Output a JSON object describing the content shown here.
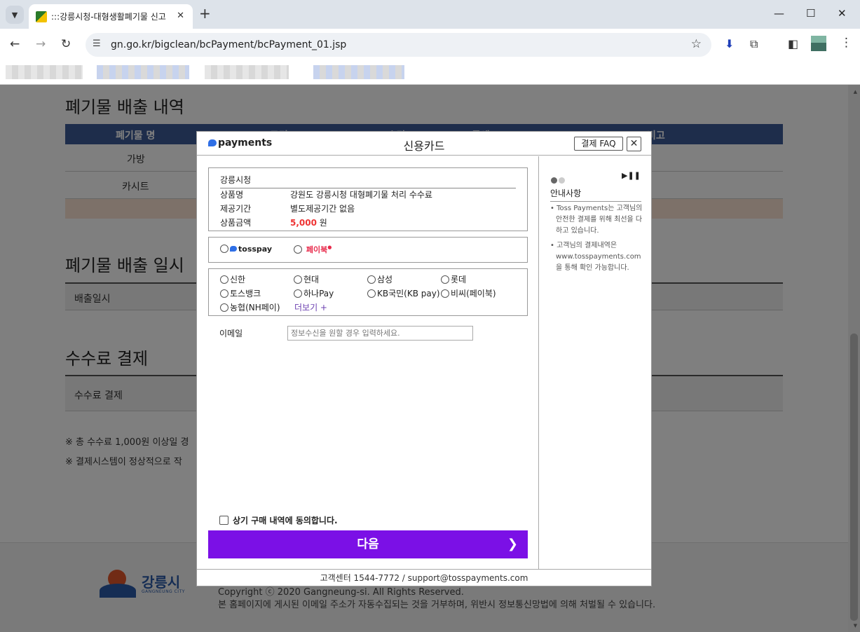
{
  "browser": {
    "tab_title": ":::강릉시청-대형생활폐기물 신고",
    "url": "gn.go.kr/bigclean/bcPayment/bcPayment_01.jsp"
  },
  "page": {
    "section1_title": "폐기물 배출 내역",
    "table_headers": [
      "폐기물 명",
      "규격",
      "수량",
      "금액",
      "비고"
    ],
    "table_rows": [
      {
        "name": "가방"
      },
      {
        "name": "카시트"
      }
    ],
    "section2_title": "폐기물 배출 일시",
    "dispose_label": "배출일시",
    "section3_title": "수수료 결제",
    "fee_label": "수수료 결제",
    "note1": "※ 총 수수료 1,000원 이상일 경",
    "note2": "※ 결제시스템이 정상적으로 작",
    "footer": {
      "logo_text": "강릉시",
      "logo_sub": "GANGNEUNG CITY",
      "copyright": "Copyright ⓒ 2020 Gangneung-si. All Rights Reserved.",
      "notice": "본 홈페이지에 게시된 이메일 주소가 자동수집되는 것을 거부하며, 위반시 정보통신망법에 의해 처벌될 수 있습니다."
    }
  },
  "modal": {
    "brand": "payments",
    "title": "신용카드",
    "faq_label": "결제 FAQ",
    "close_label": "✕",
    "merchant": "강릉시청",
    "product_label": "상품명",
    "product_value": "강원도 강릉시청 대형폐기물 처리 수수료",
    "period_label": "제공기간",
    "period_value": "별도제공기간 없음",
    "amount_label": "상품금액",
    "amount_value": "5,000",
    "amount_unit": "원",
    "easy_pay": [
      "tosspay",
      "페이북"
    ],
    "cards": [
      "신한",
      "현대",
      "삼성",
      "롯데",
      "토스뱅크",
      "하나Pay",
      "KB국민(KB pay)",
      "비씨(페이북)",
      "농협(NH페이)"
    ],
    "more_label": "더보기 +",
    "email_label": "이메일",
    "email_placeholder": "정보수신을 원할 경우 입력하세요.",
    "agree_label": "상기 구매 내역에 동의합니다.",
    "next_label": "다음",
    "guide_title": "안내사항",
    "guide_items": [
      "• Toss Payments는 고객님의 안전한 결제를 위해 최선을 다하고 있습니다.",
      "• 고객님의 결제내역은 www.tosspayments.com을 통해 확인 가능합니다."
    ],
    "footer": "고객센터 1544-7772 / support@tosspayments.com"
  },
  "colors": {
    "table_header": "#3d5a96",
    "next_button": "#7b10e6",
    "price": "#e33333"
  }
}
